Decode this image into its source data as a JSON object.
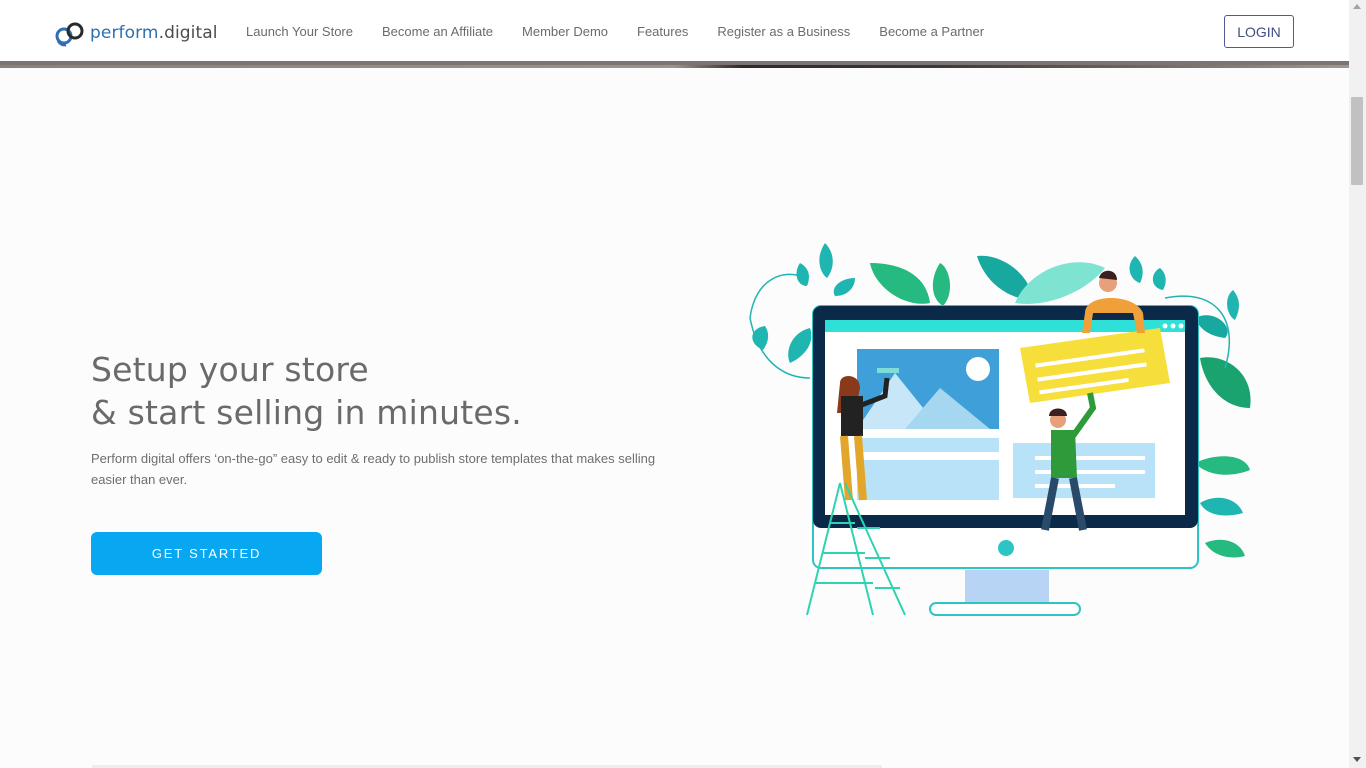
{
  "brand": {
    "name_main": "perform",
    "name_suffix": ".digital",
    "colors": {
      "logo_blue": "#2e6fb4",
      "cta_blue": "#07a8f1",
      "login_border": "#4b5d8c"
    }
  },
  "nav": {
    "items": [
      "Launch Your Store",
      "Become an Affiliate",
      "Member Demo",
      "Features",
      "Register as a Business",
      "Become a Partner"
    ],
    "login_label": "LOGIN"
  },
  "hero": {
    "title_line1": "Setup your store",
    "title_line2": "& start selling in minutes.",
    "description": "Perform digital offers ‘on-the-go” easy to edit & ready to publish store templates that makes selling easier than ever.",
    "cta_label": "GET STARTED",
    "illustration_icon": "store-setup-illustration"
  }
}
